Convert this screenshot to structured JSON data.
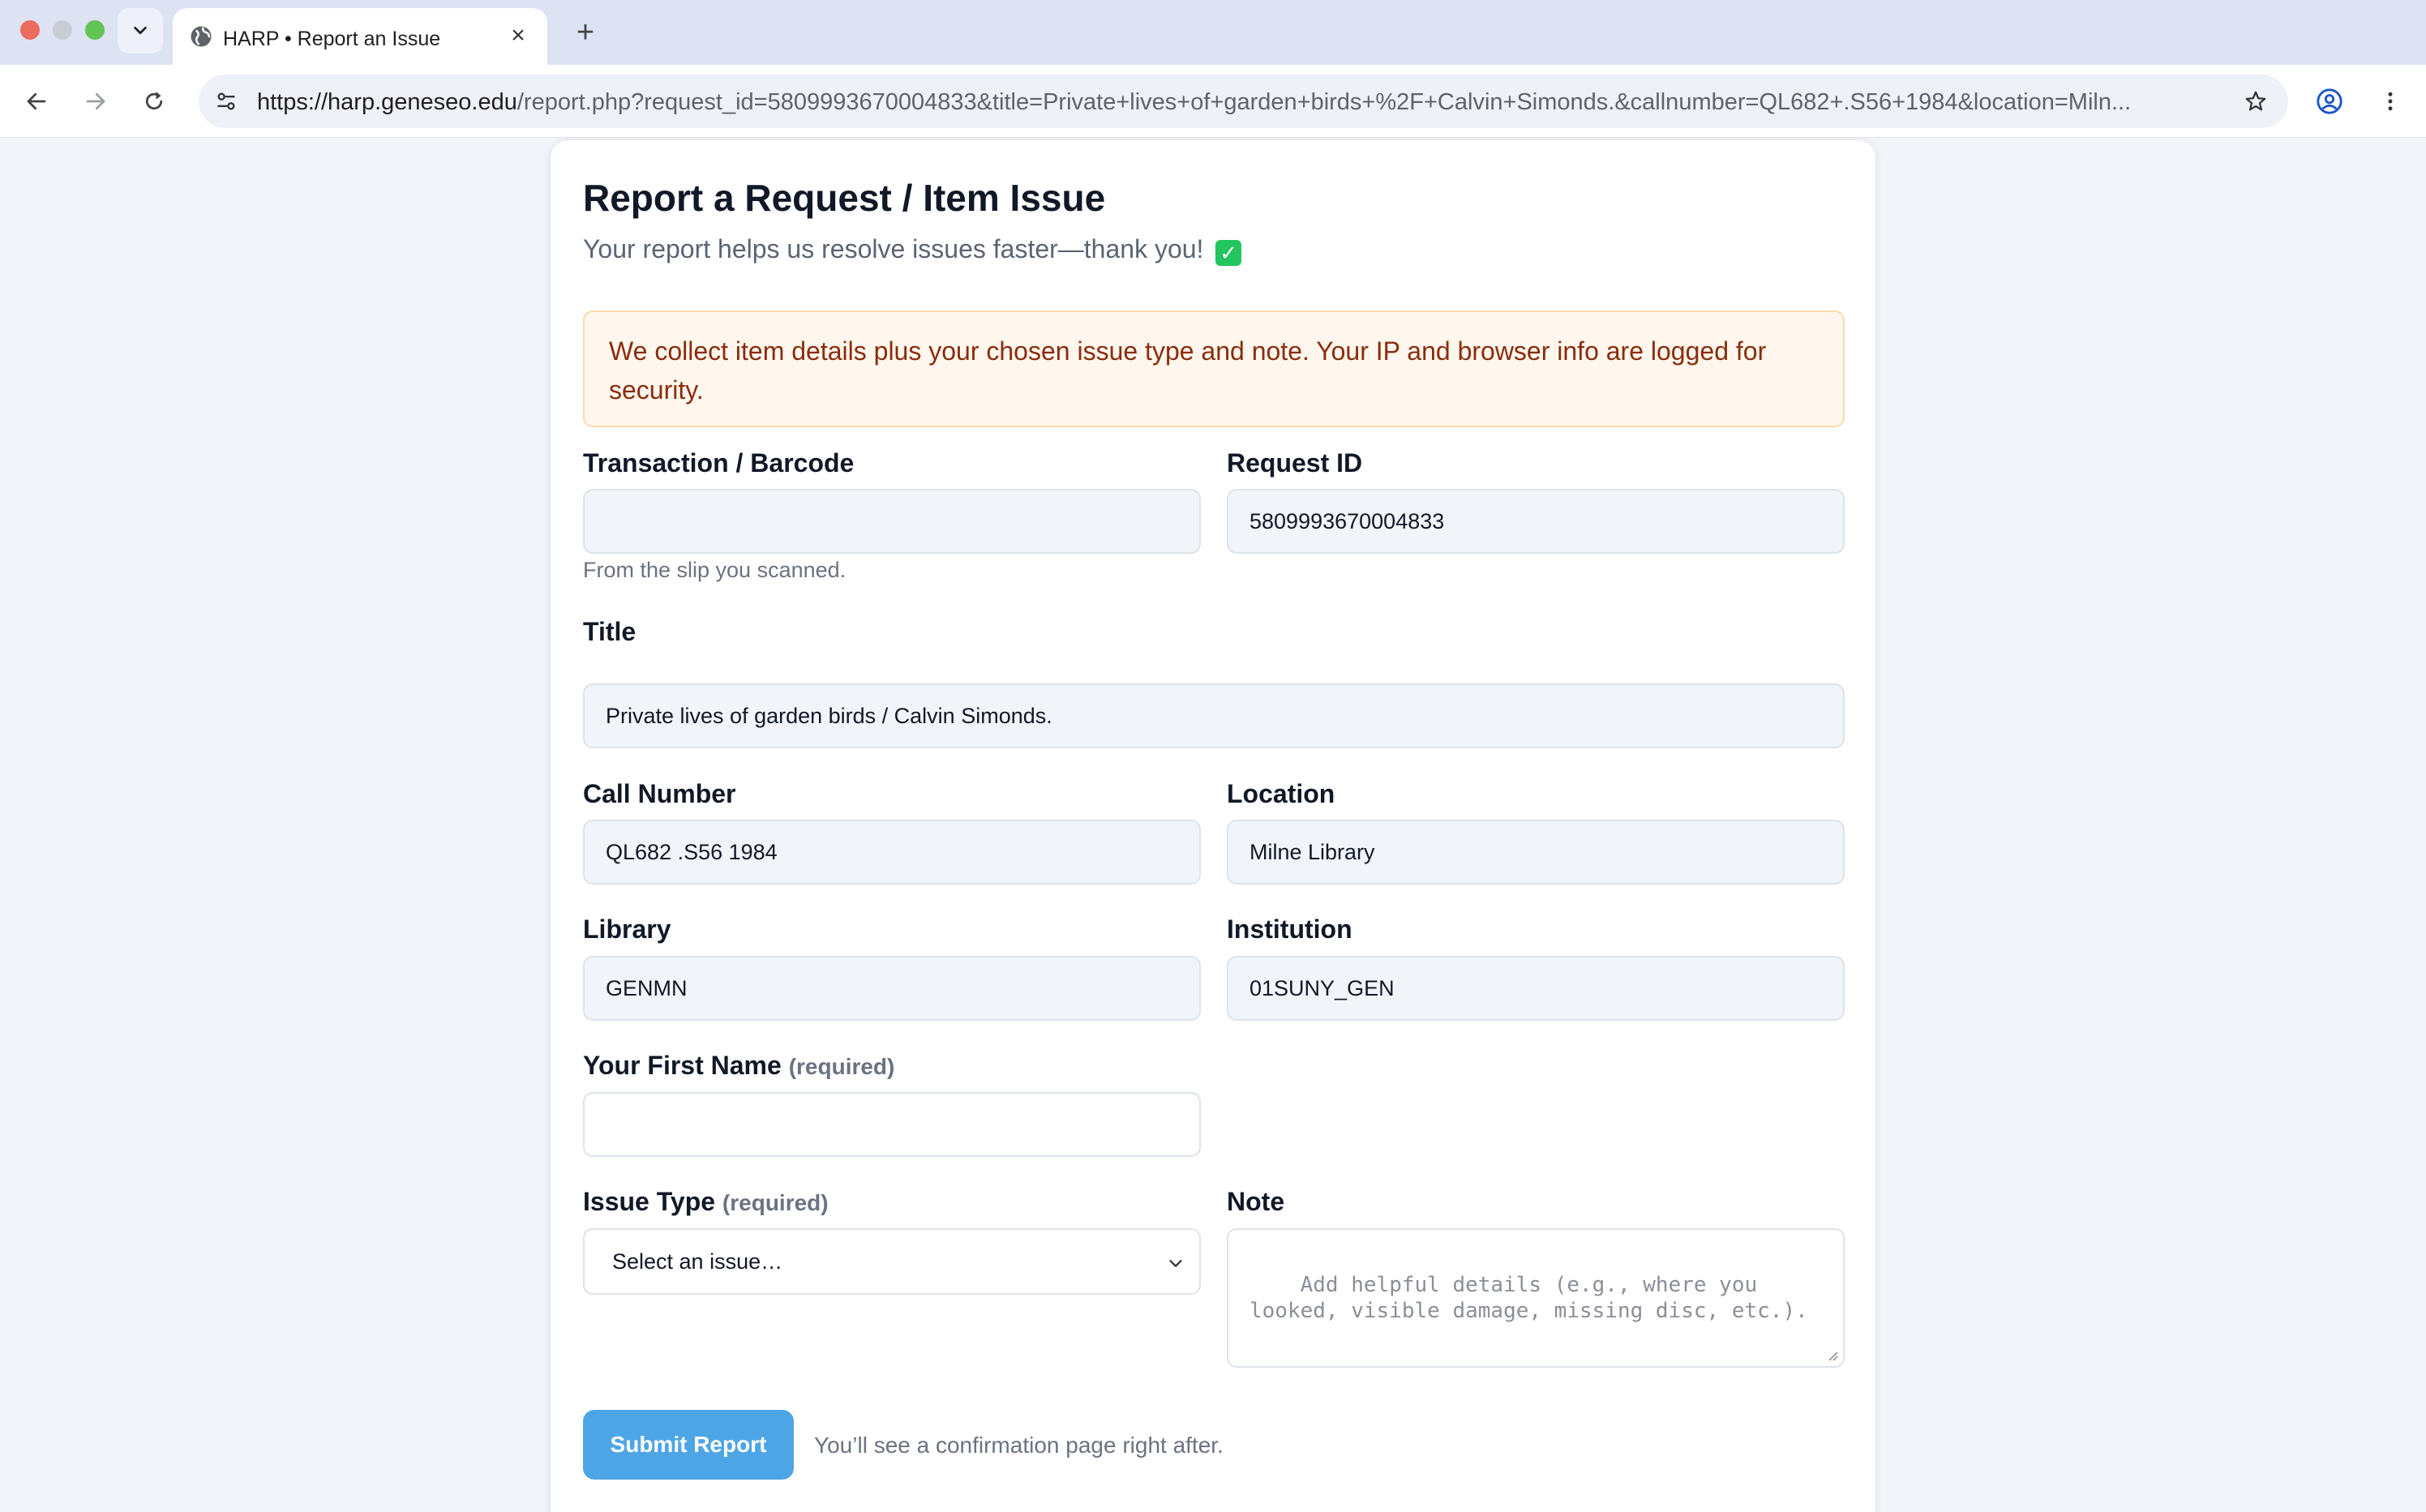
{
  "browser": {
    "tab_title": "HARP • Report an Issue",
    "url_host": "https://harp.geneseo.edu",
    "url_path": "/report.php?request_id=5809993670004833&title=Private+lives+of+garden+birds+%2F+Calvin+Simonds.&callnumber=QL682+.S56+1984&location=Miln..."
  },
  "page": {
    "title": "Report a Request / Item Issue",
    "subtitle": "Your report helps us resolve issues faster—thank you!",
    "notice": "We collect item details plus your chosen issue type and note. Your IP and browser info are logged for security."
  },
  "form": {
    "transaction": {
      "label": "Transaction / Barcode",
      "value": "",
      "help": "From the slip you scanned."
    },
    "request_id": {
      "label": "Request ID",
      "value": "5809993670004833"
    },
    "title": {
      "label": "Title",
      "value": "Private lives of garden birds / Calvin Simonds."
    },
    "call_number": {
      "label": "Call Number",
      "value": "QL682 .S56 1984"
    },
    "location": {
      "label": "Location",
      "value": "Milne Library"
    },
    "library": {
      "label": "Library",
      "value": "GENMN"
    },
    "institution": {
      "label": "Institution",
      "value": "01SUNY_GEN"
    },
    "first_name": {
      "label": "Your First Name",
      "required": "(required)",
      "value": ""
    },
    "issue_type": {
      "label": "Issue Type",
      "required": "(required)",
      "selected": "Select an issue…"
    },
    "note": {
      "label": "Note",
      "placeholder": "Add helpful details (e.g., where you looked, visible damage, missing disc, etc.)."
    },
    "submit_label": "Submit Report",
    "after_submit": "You’ll see a confirmation page right after."
  },
  "colors": {
    "accent": "#4ea5e6",
    "notice_bg": "#fff7ed",
    "notice_text": "#8a2c0d",
    "page_bg": "#f1f5f9"
  }
}
